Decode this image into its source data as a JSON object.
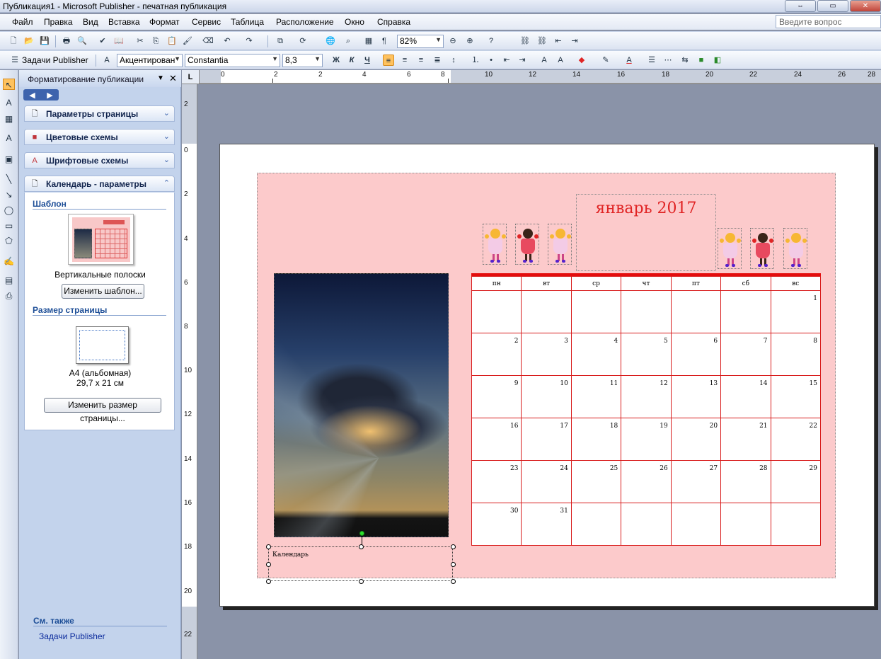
{
  "window": {
    "title": "Публикация1 - Microsoft Publisher - печатная публикация"
  },
  "menu": {
    "items": [
      "Файл",
      "Правка",
      "Вид",
      "Вставка",
      "Формат",
      "Сервис",
      "Таблица",
      "Расположение",
      "Окно",
      "Справка"
    ]
  },
  "ask_placeholder": "Введите вопрос",
  "standard_toolbar": {
    "zoom": "82%"
  },
  "format_toolbar": {
    "tasks_label": "Задачи Publisher",
    "style": "Акцентирован",
    "font": "Constantia",
    "size": "8,3",
    "bold": "Ж",
    "italic": "К",
    "underline": "Ч"
  },
  "taskpane": {
    "title": "Форматирование публикации",
    "sections": [
      "Параметры страницы",
      "Цветовые схемы",
      "Шрифтовые схемы",
      "Календарь - параметры"
    ],
    "template_heading": "Шаблон",
    "template_name": "Вертикальные полоски",
    "change_template_button": "Изменить шаблон...",
    "page_size_heading": "Размер страницы",
    "page_size_name": "A4 (альбомная)",
    "page_size_dims": "29,7 x 21 см",
    "change_size_button": "Изменить размер страницы...",
    "see_also": "См. также",
    "see_also_link": "Задачи Publisher"
  },
  "ruler": {
    "corner": "L",
    "h_labels": [
      "0",
      "2",
      "2",
      "4",
      "6",
      "8",
      "10",
      "12",
      "14",
      "16",
      "18",
      "20",
      "22",
      "24",
      "26",
      "28"
    ],
    "v_labels": [
      "2",
      "0",
      "2",
      "4",
      "6",
      "8",
      "10",
      "12",
      "14",
      "16",
      "18",
      "20",
      "22"
    ]
  },
  "calendar": {
    "month_title": "январь 2017",
    "weekdays": [
      "пн",
      "вт",
      "ср",
      "чт",
      "пт",
      "сб",
      "вс"
    ],
    "weeks": [
      [
        "",
        "",
        "",
        "",
        "",
        "",
        "1"
      ],
      [
        "2",
        "3",
        "4",
        "5",
        "6",
        "7",
        "8"
      ],
      [
        "9",
        "10",
        "11",
        "12",
        "13",
        "14",
        "15"
      ],
      [
        "16",
        "17",
        "18",
        "19",
        "20",
        "21",
        "22"
      ],
      [
        "23",
        "24",
        "25",
        "26",
        "27",
        "28",
        "29"
      ],
      [
        "30",
        "31",
        "",
        "",
        "",
        "",
        ""
      ]
    ],
    "caption": "Календарь"
  },
  "colors": {
    "accent": "#e02424",
    "background": "#fccacb"
  }
}
